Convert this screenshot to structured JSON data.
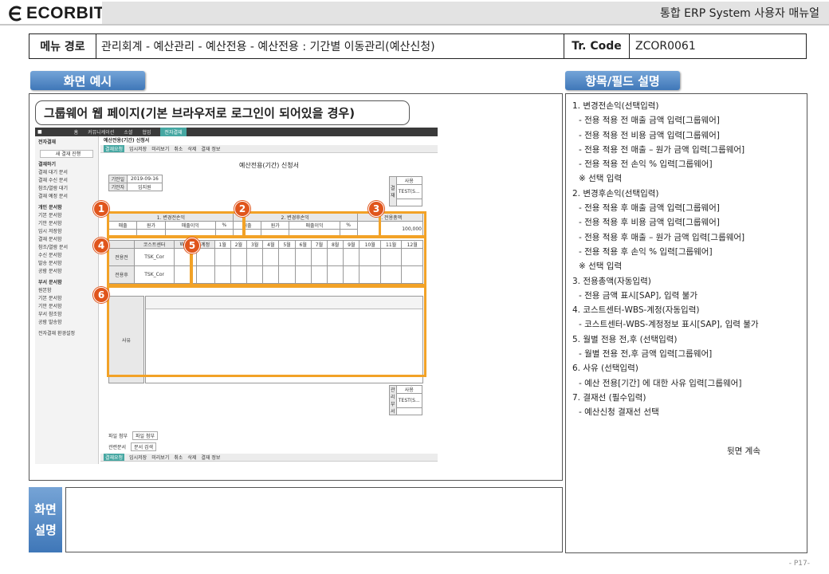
{
  "header": {
    "logo": "ECORBIT",
    "manual_title": "통합 ERP System 사용자 매뉴얼"
  },
  "menu_row": {
    "label": "메뉴 경로",
    "path": "관리회계 - 예산관리 - 예산전용 - 예산전용 : 기간별 이동관리(예산신청)",
    "tr_label": "Tr. Code",
    "tr_code": "ZCOR0061"
  },
  "tabs": {
    "screen_example": "화면 예시",
    "field_desc": "항목/필드 설명"
  },
  "caption": "그룹웨어 웹 페이지(기본 브라우저로 로그인이 되어있을 경우)",
  "groupware": {
    "top_menu": [
      "홈",
      "커뮤니케이션",
      "소셜",
      "협업",
      "전자결재"
    ],
    "sidebar": [
      "전자결재",
      "새 결재 진행",
      "결재하기",
      "결재 대기 문서",
      "결재 수신 문서",
      "참조/열람 대기",
      "결재 예정 문서",
      "개인 문서함",
      "기본 문서함",
      "기안 문서함",
      "임시 저장함",
      "결재 문서함",
      "참조/열람 문서",
      "수신 문서함",
      "발송 문서함",
      "공람 문서함",
      "부서 문서함",
      "원본함",
      "기본 문서함",
      "기안 문서함",
      "부서 참조함",
      "공람 발송함",
      "전자결재 환경설정"
    ],
    "page_heading": "예산전용(기간) 신청서",
    "toolbar": [
      "결재요청",
      "임시저장",
      "미리보기",
      "취소",
      "삭제",
      "결재 정보"
    ],
    "form_title": "예산전용(기간) 신청서",
    "draft_date": "2019-09-16",
    "drafter": "임지원",
    "sec1": "1. 변경전손익",
    "sec2": "2. 변경후손익",
    "sec3": "3. 전용총액",
    "pl_cols": [
      "매출",
      "원가",
      "매출이익",
      "%"
    ],
    "total": "100,000",
    "cc_cols": [
      "코스트센터",
      "WBS",
      "계정"
    ],
    "months": [
      "1월",
      "2월",
      "3월",
      "4월",
      "5월",
      "6월",
      "7월",
      "8월",
      "9월",
      "10월",
      "11월",
      "12월"
    ],
    "row_before": "전용전",
    "row_after": "전용후",
    "cc_value": "TSK_Cor",
    "reason": "사유",
    "attach": "파일 첨부",
    "attach_btn": "파일 첨부",
    "related": "관련문서",
    "related_btn": "문서 검색",
    "approval_label": "사용",
    "approval_name": "TEST(S..."
  },
  "field_desc": {
    "items": [
      {
        "title": "1. 변경전손익(선택입력)",
        "lines": [
          "- 전용 적용 전 매출 금액 입력[그룹웨어]",
          "- 전용 적용 전 비용 금액 입력[그룹웨어]",
          "- 전용 적용 전 매출 – 원가 금액 입력[그룹웨어]",
          "- 전용 적용 전 손익 % 입력[그룹웨어]",
          "※ 선택 입력"
        ]
      },
      {
        "title": "2. 변경후손익(선택입력)",
        "lines": [
          "- 전용 적용 후 매출 금액 입력[그룹웨어]",
          "- 전용 적용 후 비용 금액 입력[그룹웨어]",
          "- 전용 적용 후 매출 – 원가 금액 입력[그룹웨어]",
          "- 전용 적용 후 손익 % 입력[그룹웨어]",
          "※ 선택 입력"
        ]
      },
      {
        "title": "3. 전용총액(자동입력)",
        "lines": [
          "- 전용 금액 표시[SAP], 입력 불가"
        ]
      },
      {
        "title": "4. 코스트센터-WBS-계정(자동입력)",
        "lines": [
          "- 코스트센터-WBS-계정정보 표시[SAP], 입력 불가"
        ]
      },
      {
        "title": "5. 월별 전용 전,후 (선택입력)",
        "lines": [
          "- 월별 전용 전,후 금액 입력[그룹웨어]"
        ]
      },
      {
        "title": "6. 사유 (선택입력)",
        "lines": [
          "- 예산 전용[기간] 에 대한 사유 입력[그룹웨어]"
        ]
      },
      {
        "title": "7. 결재선 (필수입력)",
        "lines": [
          "- 예산신청 결재선 선택"
        ]
      }
    ],
    "continued": "뒷면 계속"
  },
  "bottom": {
    "label_line1": "화면",
    "label_line2": "설명"
  },
  "page_number": "- P17-",
  "colors": {
    "accent_blue": "#3f77b8",
    "highlight_orange": "#f2a227",
    "marker_red": "#e0551c",
    "groupware_teal": "#46a7a2"
  }
}
